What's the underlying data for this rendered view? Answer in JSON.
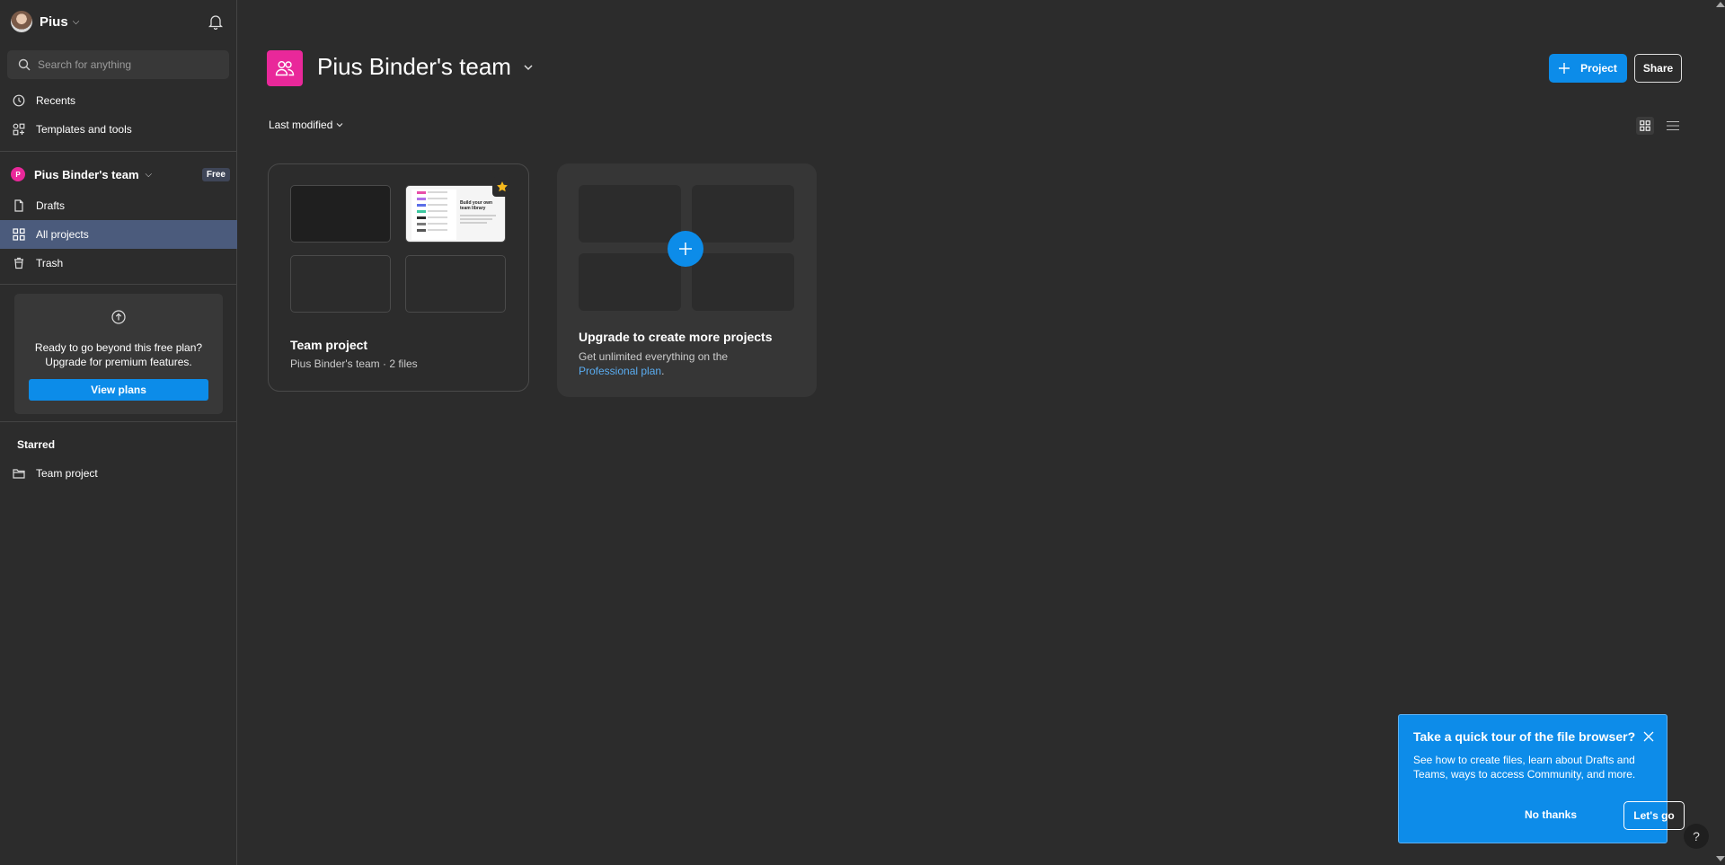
{
  "sidebar": {
    "user_name": "Pius",
    "search_placeholder": "Search for anything",
    "nav": {
      "recents": "Recents",
      "templates": "Templates and tools"
    },
    "team": {
      "initial": "P",
      "name": "Pius Binder's team",
      "plan_badge": "Free"
    },
    "team_nav": {
      "drafts": "Drafts",
      "all_projects": "All projects",
      "trash": "Trash"
    },
    "upgrade": {
      "line1": "Ready to go beyond this free plan?",
      "line2": "Upgrade for premium features.",
      "button": "View plans"
    },
    "starred": {
      "label": "Starred",
      "items": [
        "Team project"
      ]
    }
  },
  "header": {
    "title": "Pius Binder's team",
    "new_project_label": "Project",
    "share_label": "Share"
  },
  "toolbar": {
    "sort_label": "Last modified"
  },
  "projects": [
    {
      "title": "Team project",
      "subtitle": "Pius Binder's team · 2 files",
      "thumbnail_text": "Build your own team library",
      "starred": true
    }
  ],
  "upgrade_card": {
    "title": "Upgrade to create more projects",
    "text": "Get unlimited everything on the",
    "link": "Professional plan",
    "link_suffix": "."
  },
  "tour": {
    "title": "Take a quick tour of the file browser?",
    "text": "See how to create files, learn about Drafts and Teams, ways to access Community, and more.",
    "dismiss": "No thanks",
    "confirm": "Let's go"
  },
  "help_label": "?",
  "colors": {
    "accent": "#0c8ce9",
    "team": "#e9289a",
    "background": "#2c2c2c",
    "active_nav": "#4b5b7c"
  }
}
